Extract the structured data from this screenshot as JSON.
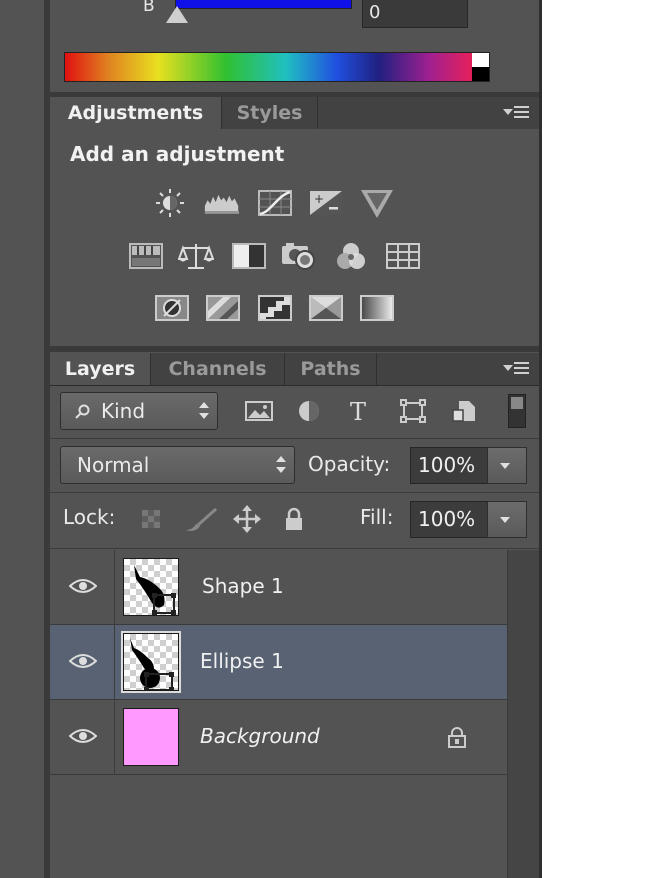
{
  "color_panel": {
    "channel_label": "B",
    "channel_value": "0"
  },
  "adjustments_panel": {
    "tabs": [
      {
        "label": "Adjustments",
        "active": true
      },
      {
        "label": "Styles",
        "active": false
      }
    ],
    "heading": "Add an adjustment",
    "icons_row1": [
      "brightness-contrast-icon",
      "levels-icon",
      "curves-icon",
      "exposure-icon",
      "vibrance-icon"
    ],
    "icons_row2": [
      "hue-saturation-icon",
      "color-balance-icon",
      "black-white-icon",
      "photo-filter-icon",
      "channel-mixer-icon",
      "color-lookup-icon"
    ],
    "icons_row3": [
      "invert-icon",
      "posterize-icon",
      "threshold-icon",
      "selective-color-icon",
      "gradient-map-icon"
    ]
  },
  "layers_panel": {
    "tabs": [
      {
        "label": "Layers",
        "active": true
      },
      {
        "label": "Channels",
        "active": false
      },
      {
        "label": "Paths",
        "active": false
      }
    ],
    "filter_kind": "Kind",
    "blend_mode": "Normal",
    "opacity_label": "Opacity:",
    "opacity_value": "100%",
    "lock_label": "Lock:",
    "fill_label": "Fill:",
    "fill_value": "100%",
    "layers": [
      {
        "name": "Shape 1",
        "visible": true,
        "selected": false,
        "locked": false
      },
      {
        "name": "Ellipse 1",
        "visible": true,
        "selected": true,
        "locked": false
      },
      {
        "name": "Background",
        "visible": true,
        "selected": false,
        "locked": true
      }
    ],
    "background_color": "#ff99ff"
  },
  "colors": {
    "panel_bg": "#535353",
    "selection": "#586272",
    "b_slider": "#1010e8"
  }
}
